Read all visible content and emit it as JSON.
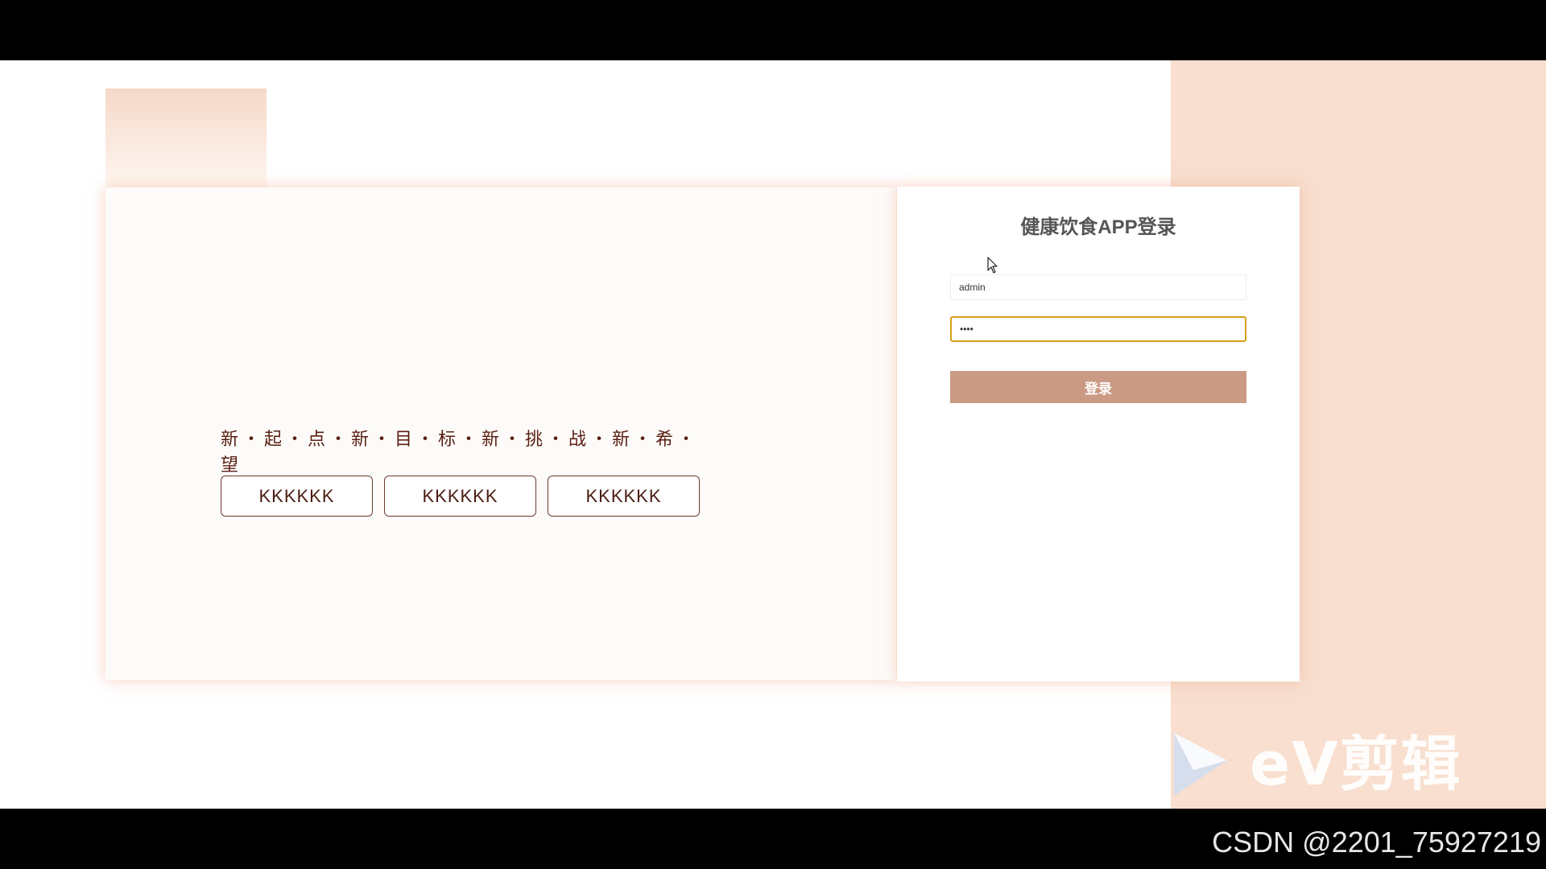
{
  "hero": {
    "slogan": "新・起・点・新・目・标・新・挑・战・新・希・望",
    "buttons": [
      "KKKKKK",
      "KKKKKK",
      "KKKKKK"
    ]
  },
  "login": {
    "title": "健康饮食APP登录",
    "username_value": "admin",
    "password_value": "••••",
    "submit_label": "登录"
  },
  "overlay": {
    "watermark_text": "eV剪辑",
    "credit_text": "CSDN @2201_75927219"
  },
  "icons": {
    "cursor": "mouse-pointer-icon",
    "watermark_logo": "play-triangle-icon"
  },
  "colors": {
    "accent_band": "#f8dfcf",
    "login_button": "#cb9a85",
    "focus_border": "#d4a017",
    "slogan_text": "#5a1f12"
  }
}
